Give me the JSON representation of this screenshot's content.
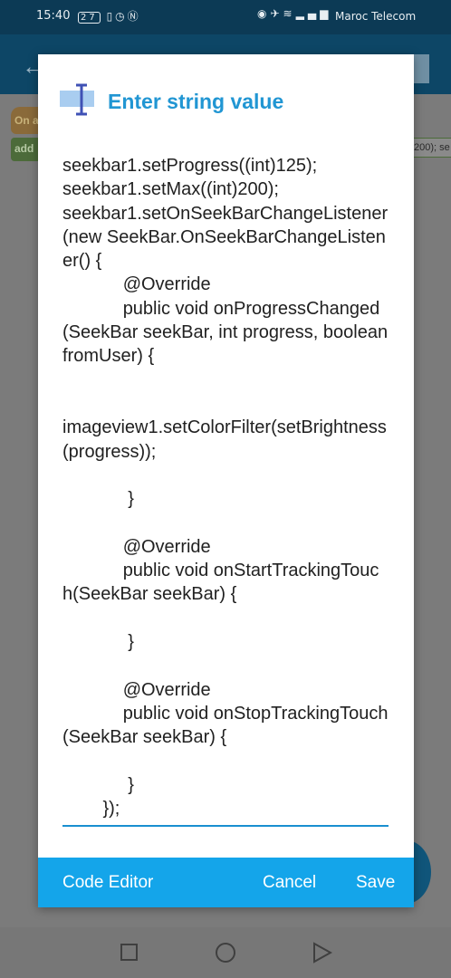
{
  "status_bar": {
    "time": "15:40",
    "battery": "27",
    "carrier": "Maroc Telecom"
  },
  "background": {
    "block_orange_label": "On a",
    "block_green_label": "add",
    "block_right_text": "200); se"
  },
  "dialog": {
    "title": "Enter string value",
    "icon": "text-cursor-icon",
    "code": "seekbar1.setProgress((int)125);\nseekbar1.setMax((int)200);\nseekbar1.setOnSeekBarChangeListener(new SeekBar.OnSeekBarChangeListener() {\n            @Override\n            public void onProgressChanged(SeekBar seekBar, int progress, boolean fromUser) {\n\n\nimageview1.setColorFilter(setBrightness(progress));\n\n             }\n\n            @Override\n            public void onStartTrackingTouch(SeekBar seekBar) {\n\n             }\n\n            @Override\n            public void onStopTrackingTouch(SeekBar seekBar) {\n\n             }\n        });",
    "buttons": {
      "code_editor": "Code Editor",
      "cancel": "Cancel",
      "save": "Save"
    }
  },
  "colors": {
    "accent": "#2196d3",
    "footer": "#14a5ea",
    "status_bar": "#0c3a55"
  }
}
